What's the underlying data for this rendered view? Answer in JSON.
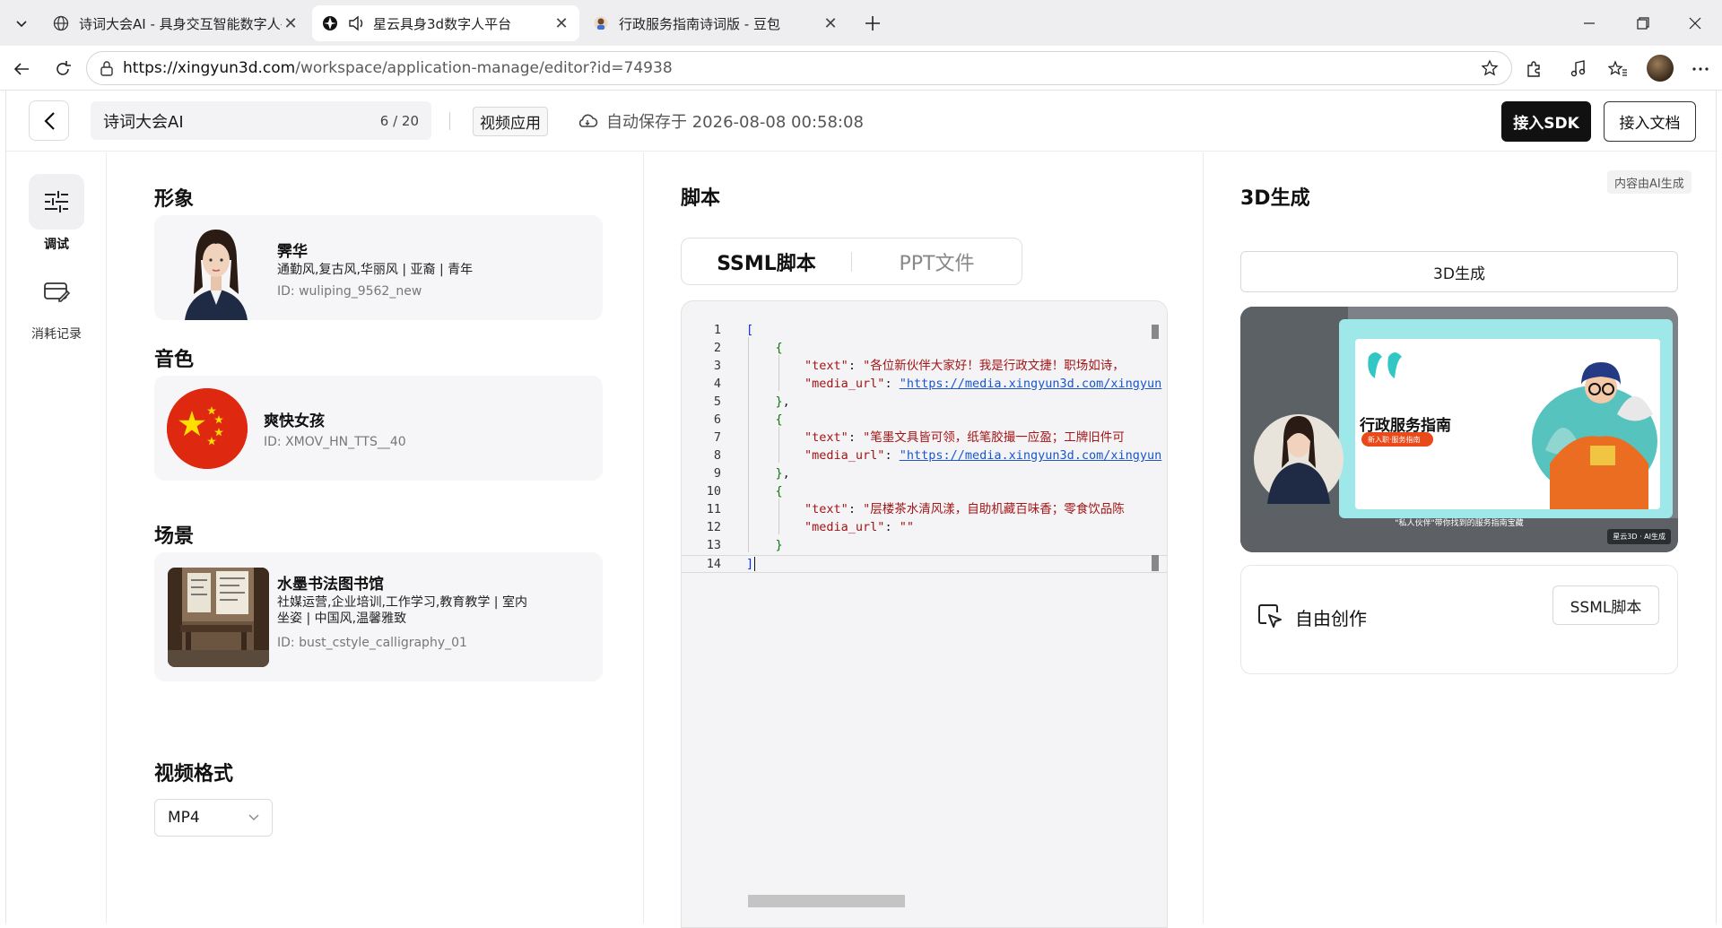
{
  "browser": {
    "tabs": [
      {
        "title": "诗词大会AI - 具身交互智能数字人平台",
        "icon": "globe-icon"
      },
      {
        "title": "星云具身3d数字人平台",
        "icon": "app-logo-icon"
      },
      {
        "title": "行政服务指南诗词版 - 豆包",
        "icon": "doubao-icon"
      }
    ],
    "url_host": "https://xingyun3d.com",
    "url_path": "/workspace/application-manage/editor?id=74938"
  },
  "header": {
    "app_name": "诗词大会AI",
    "name_count": "6 / 20",
    "app_type": "视频应用",
    "autosave": "自动保存于 2026-08-08 00:58:08",
    "sdk_button": "接入SDK",
    "doc_button": "接入文档"
  },
  "rail": {
    "items": [
      {
        "label": "调试",
        "icon": "sliders-icon",
        "active": true
      },
      {
        "label": "消耗记录",
        "icon": "wallet-icon",
        "active": false
      }
    ]
  },
  "config": {
    "avatar_title": "形象",
    "avatar": {
      "name": "霁华",
      "tags": "通勤风,复古风,华丽风 | 亚裔 | 青年",
      "id": "ID: wuliping_9562_new"
    },
    "voice_title": "音色",
    "voice": {
      "name": "爽快女孩",
      "id": "ID: XMOV_HN_TTS__40"
    },
    "scene_title": "场景",
    "scene": {
      "name": "水墨书法图书馆",
      "tags_line1": "社媒运营,企业培训,工作学习,教育教学 | 室内",
      "tags_line2": "坐姿 | 中国风,温馨雅致",
      "id": "ID: bust_cstyle_calligraphy_01"
    },
    "format_title": "视频格式",
    "format_value": "MP4"
  },
  "script": {
    "title": "脚本",
    "tabs": [
      "SSML脚本",
      "PPT文件"
    ],
    "active_tab": 0,
    "line_numbers": [
      "1",
      "2",
      "3",
      "4",
      "5",
      "6",
      "7",
      "8",
      "9",
      "10",
      "11",
      "12",
      "13",
      "14"
    ],
    "texts": [
      "\"各位新伙伴大家好！我是行政文捷！职场如诗，",
      "\"笔墨文具皆可领，纸笔胶撮一应盈；工牌旧件可",
      "\"层楼茶水清风漾，自助机藏百味香；零食饮品陈"
    ],
    "media_url": "\"https://media.xingyun3d.com/xingyun",
    "media_key": "\"media_url\"",
    "text_key": "\"text\"",
    "empty_str": "\"\""
  },
  "gen3d": {
    "title": "3D生成",
    "ai_badge": "内容由AI生成",
    "generate_button": "3D生成",
    "preview": {
      "slide_title": "行政服务指南",
      "slide_sub": "新入职·服务指南",
      "caption": "\"私人伙伴\"带你找到的服务指南宝藏",
      "brand": "星云3D · AI生成"
    },
    "free_create": "自由创作",
    "ssml_button": "SSML脚本"
  }
}
